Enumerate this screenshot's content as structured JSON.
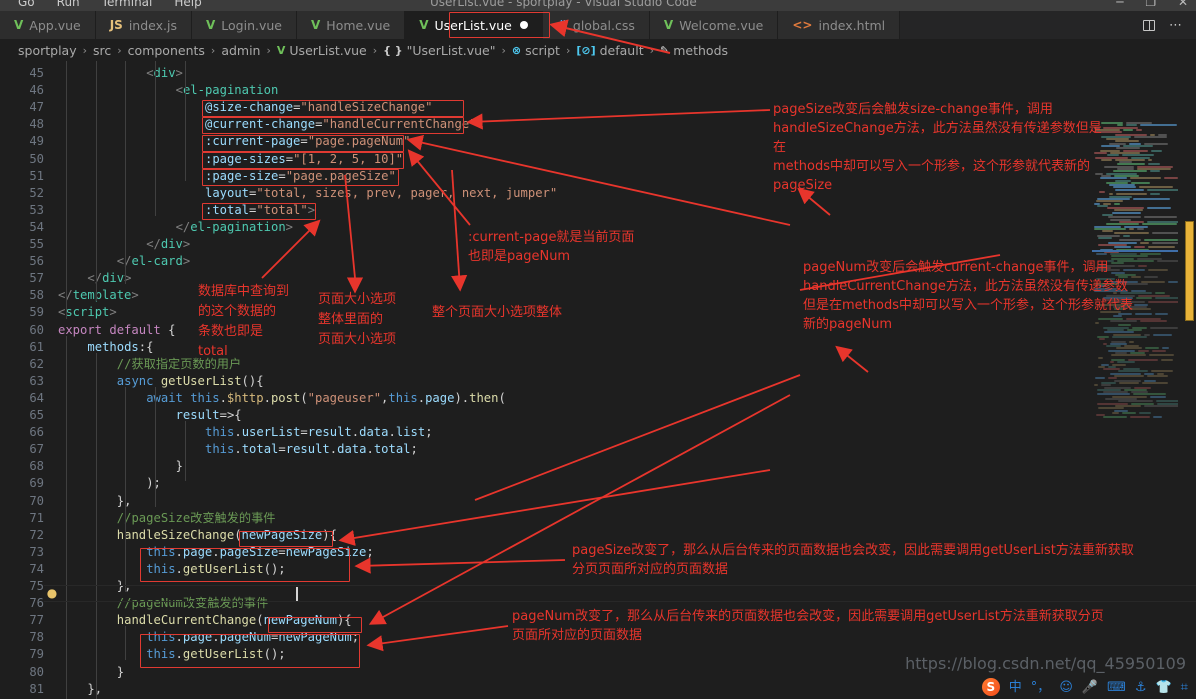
{
  "window": {
    "title": "UserList.vue - sportplay - Visual Studio Code",
    "menu": [
      "Go",
      "Run",
      "Terminal",
      "Help"
    ],
    "minimize": "─",
    "maximize": "❐",
    "close": "✕"
  },
  "tabs": [
    {
      "label": "App.vue",
      "icon": "vue-icon",
      "glyph": "V",
      "active": false,
      "dirty": false
    },
    {
      "label": "index.js",
      "icon": "js-icon",
      "glyph": "JS",
      "active": false,
      "dirty": false
    },
    {
      "label": "Login.vue",
      "icon": "vue-icon",
      "glyph": "V",
      "active": false,
      "dirty": false
    },
    {
      "label": "Home.vue",
      "icon": "vue-icon",
      "glyph": "V",
      "active": false,
      "dirty": false
    },
    {
      "label": "UserList.vue",
      "icon": "vue-icon",
      "glyph": "V",
      "active": true,
      "dirty": true
    },
    {
      "label": "global.css",
      "icon": "css-icon",
      "glyph": "#",
      "active": false,
      "dirty": false
    },
    {
      "label": "Welcome.vue",
      "icon": "vue-icon",
      "glyph": "V",
      "active": false,
      "dirty": false
    },
    {
      "label": "index.html",
      "icon": "html-icon",
      "glyph": "<>",
      "active": false,
      "dirty": false
    }
  ],
  "tab_actions": {
    "split_editor": "Split Editor",
    "more": "⋯"
  },
  "breadcrumb": [
    {
      "label": "sportplay",
      "icon": ""
    },
    {
      "label": "src",
      "icon": ""
    },
    {
      "label": "components",
      "icon": ""
    },
    {
      "label": "admin",
      "icon": ""
    },
    {
      "label": "UserList.vue",
      "icon": "V"
    },
    {
      "label": "\"UserList.vue\"",
      "icon": "{ }"
    },
    {
      "label": "script",
      "icon": "⊗"
    },
    {
      "label": "default",
      "icon": "[⊘]"
    },
    {
      "label": "methods",
      "icon": "✎"
    }
  ],
  "code": {
    "first_line": 45,
    "lines": [
      {
        "n": 45,
        "html": "<span class='t-brack'>&lt;</span><span class='t-tag'>div</span><span class='t-brack'>&gt;</span>",
        "indent": 12
      },
      {
        "n": 46,
        "html": "<span class='t-brack'>&lt;</span><span class='t-tag'>el-pagination</span>",
        "indent": 16
      },
      {
        "n": 47,
        "html": "<span class='t-attr'>@size-change</span><span class='t-punc'>=</span><span class='t-str'>\"handleSizeChange\"</span>",
        "indent": 20
      },
      {
        "n": 48,
        "html": "<span class='t-attr'>@current-change</span><span class='t-punc'>=</span><span class='t-str'>\"handleCurrentChange\"</span>",
        "indent": 20
      },
      {
        "n": 49,
        "html": "<span class='t-attr'>:current-page</span><span class='t-punc'>=</span><span class='t-str'>\"page.pageNum\"</span>",
        "indent": 20
      },
      {
        "n": 50,
        "html": "<span class='t-attr'>:page-sizes</span><span class='t-punc'>=</span><span class='t-str'>\"[1, 2, 5, 10]\"</span>",
        "indent": 20
      },
      {
        "n": 51,
        "html": "<span class='t-attr'>:page-size</span><span class='t-punc'>=</span><span class='t-str'>\"page.pageSize\"</span>",
        "indent": 20
      },
      {
        "n": 52,
        "html": "<span class='t-attr'>layout</span><span class='t-punc'>=</span><span class='t-str'>\"total, sizes, prev, pager, next, jumper\"</span>",
        "indent": 20
      },
      {
        "n": 53,
        "html": "<span class='t-attr'>:total</span><span class='t-punc'>=</span><span class='t-str'>\"total\"</span><span class='t-brack'>&gt;</span>",
        "indent": 20
      },
      {
        "n": 54,
        "html": "<span class='t-brack'>&lt;/</span><span class='t-tag'>el-pagination</span><span class='t-brack'>&gt;</span>",
        "indent": 16
      },
      {
        "n": 55,
        "html": "<span class='t-brack'>&lt;/</span><span class='t-tag'>div</span><span class='t-brack'>&gt;</span>",
        "indent": 12
      },
      {
        "n": 56,
        "html": "<span class='t-brack'>&lt;/</span><span class='t-tag'>el-card</span><span class='t-brack'>&gt;</span>",
        "indent": 8
      },
      {
        "n": 57,
        "html": "<span class='t-brack'>&lt;/</span><span class='t-tag'>div</span><span class='t-brack'>&gt;</span>",
        "indent": 4
      },
      {
        "n": 58,
        "html": "<span class='t-brack'>&lt;/</span><span class='t-tag'>template</span><span class='t-brack'>&gt;</span>",
        "indent": 0
      },
      {
        "n": 59,
        "html": "<span class='t-brack'>&lt;</span><span class='t-tag'>script</span><span class='t-brack'>&gt;</span>",
        "indent": 0
      },
      {
        "n": 60,
        "html": "<span class='t-kw'>export</span> <span class='t-kw'>default</span> <span class='t-punc'>{</span>",
        "indent": 0
      },
      {
        "n": 61,
        "html": "<span class='t-prop'>methods</span><span class='t-punc'>:{</span>",
        "indent": 4
      },
      {
        "n": 62,
        "html": "<span class='t-com'>//获取指定页数的用户</span>",
        "indent": 8
      },
      {
        "n": 63,
        "html": "<span class='t-kw2'>async</span> <span class='t-fn'>getUserList</span><span class='t-punc'>(){</span>",
        "indent": 8
      },
      {
        "n": 64,
        "html": "<span class='t-kw2'>await</span> <span class='t-this'>this</span><span class='t-punc'>.</span><span class='t-yel'>$http</span><span class='t-punc'>.</span><span class='t-fn'>post</span><span class='t-punc'>(</span><span class='t-str'>\"pageuser\"</span><span class='t-punc'>,</span><span class='t-this'>this</span><span class='t-punc'>.</span><span class='t-prop'>page</span><span class='t-punc'>).</span><span class='t-fn'>then</span><span class='t-punc'>(</span>",
        "indent": 12
      },
      {
        "n": 65,
        "html": "<span class='t-var'>result</span><span class='t-punc'>=&gt;{</span>",
        "indent": 16
      },
      {
        "n": 66,
        "html": "<span class='t-this'>this</span><span class='t-punc'>.</span><span class='t-prop'>userList</span><span class='t-punc'>=</span><span class='t-var'>result</span><span class='t-punc'>.</span><span class='t-prop'>data</span><span class='t-punc'>.</span><span class='t-prop'>list</span><span class='t-punc'>;</span>",
        "indent": 20
      },
      {
        "n": 67,
        "html": "<span class='t-this'>this</span><span class='t-punc'>.</span><span class='t-prop'>total</span><span class='t-punc'>=</span><span class='t-var'>result</span><span class='t-punc'>.</span><span class='t-prop'>data</span><span class='t-punc'>.</span><span class='t-prop'>total</span><span class='t-punc'>;</span>",
        "indent": 20
      },
      {
        "n": 68,
        "html": "<span class='t-punc'>}</span>",
        "indent": 16
      },
      {
        "n": 69,
        "html": "<span class='t-punc'>);</span>",
        "indent": 12
      },
      {
        "n": 70,
        "html": "<span class='t-punc'>},</span>",
        "indent": 8
      },
      {
        "n": 71,
        "html": "<span class='t-com'>//pageSize改变触发的事件</span>",
        "indent": 8
      },
      {
        "n": 72,
        "html": "<span class='t-fn'>handleSizeChange</span><span class='t-punc'>(</span><span class='t-var'>newPageSize</span><span class='t-punc'>){</span>",
        "indent": 8
      },
      {
        "n": 73,
        "html": "<span class='t-this'>this</span><span class='t-punc'>.</span><span class='t-prop'>page</span><span class='t-punc'>.</span><span class='t-prop'>pageSize</span><span class='t-punc'>=</span><span class='t-var'>newPageSize</span><span class='t-punc'>;</span>",
        "indent": 12
      },
      {
        "n": 74,
        "html": "<span class='t-this'>this</span><span class='t-punc'>.</span><span class='t-fn'>getUserList</span><span class='t-punc'>();</span>",
        "indent": 12
      },
      {
        "n": 75,
        "html": "<span class='t-punc'>},</span>",
        "indent": 8
      },
      {
        "n": 76,
        "html": "<span class='t-com'>//pageNum改变触发的事件</span>",
        "indent": 8
      },
      {
        "n": 77,
        "html": "<span class='t-fn'>handleCurrentChange</span><span class='t-punc'>(</span><span class='t-var'>newPageNum</span><span class='t-punc'>){</span>",
        "indent": 8
      },
      {
        "n": 78,
        "html": "<span class='t-this'>this</span><span class='t-punc'>.</span><span class='t-prop'>page</span><span class='t-punc'>.</span><span class='t-prop'>pageNum</span><span class='t-punc'>=</span><span class='t-var'>newPageNum</span><span class='t-punc'>;</span>",
        "indent": 12
      },
      {
        "n": 79,
        "html": "<span class='t-this'>this</span><span class='t-punc'>.</span><span class='t-fn'>getUserList</span><span class='t-punc'>();</span>",
        "indent": 12
      },
      {
        "n": 80,
        "html": "<span class='t-punc'>}</span>",
        "indent": 8
      },
      {
        "n": 81,
        "html": "<span class='t-punc'>},</span>",
        "indent": 4
      }
    ]
  },
  "annotations": [
    {
      "id": "anno-size-change",
      "text": "pageSize改变后会触发size-change事件，调用\nhandleSizeChange方法，此方法虽然没有传递参数但是在\nmethods中却可以写入一个形参，这个形参就代表新的\npageSize"
    },
    {
      "id": "anno-current-page",
      "text": ":current-page就是当前页面\n也即是pageNum"
    },
    {
      "id": "anno-current-change",
      "text": "pageNum改变后会触发current-change事件，调用\nhandleCurrentChange方法，此方法虽然没有传递参数\n但是在methods中却可以写入一个形参，这个形参就代表\n新的pageNum"
    },
    {
      "id": "anno-total",
      "text": "数据库中查询到\n的这个数据的\n条数也即是\ntotal"
    },
    {
      "id": "anno-page-sizes",
      "text": "页面大小选项\n整体里面的\n页面大小选项"
    },
    {
      "id": "anno-page-size",
      "text": "整个页面大小选项整体"
    },
    {
      "id": "anno-size-body",
      "text": "pageSize改变了，那么从后台传来的页面数据也会改变，因此需要调用getUserList方法重新获取\n分页页面所对应的页面数据"
    },
    {
      "id": "anno-num-body",
      "text": "pageNum改变了，那么从后台传来的页面数据也会改变，因此需要调用getUserList方法重新获取分页\n页面所对应的页面数据"
    }
  ],
  "watermark": {
    "text": "https://blog.csdn.net/qq_45950109"
  },
  "ime": {
    "logo": "S",
    "items": [
      "中",
      "°，",
      "☺",
      "🎤",
      "⌨",
      "⚓",
      "👕",
      "⌗"
    ]
  },
  "colors": {
    "accent_red": "#e8352c",
    "editor_bg": "#1e1e1e",
    "tabbar_bg": "#252526",
    "active_tab_bg": "#1e1e1e",
    "scroll_marker": "#e8b339"
  }
}
